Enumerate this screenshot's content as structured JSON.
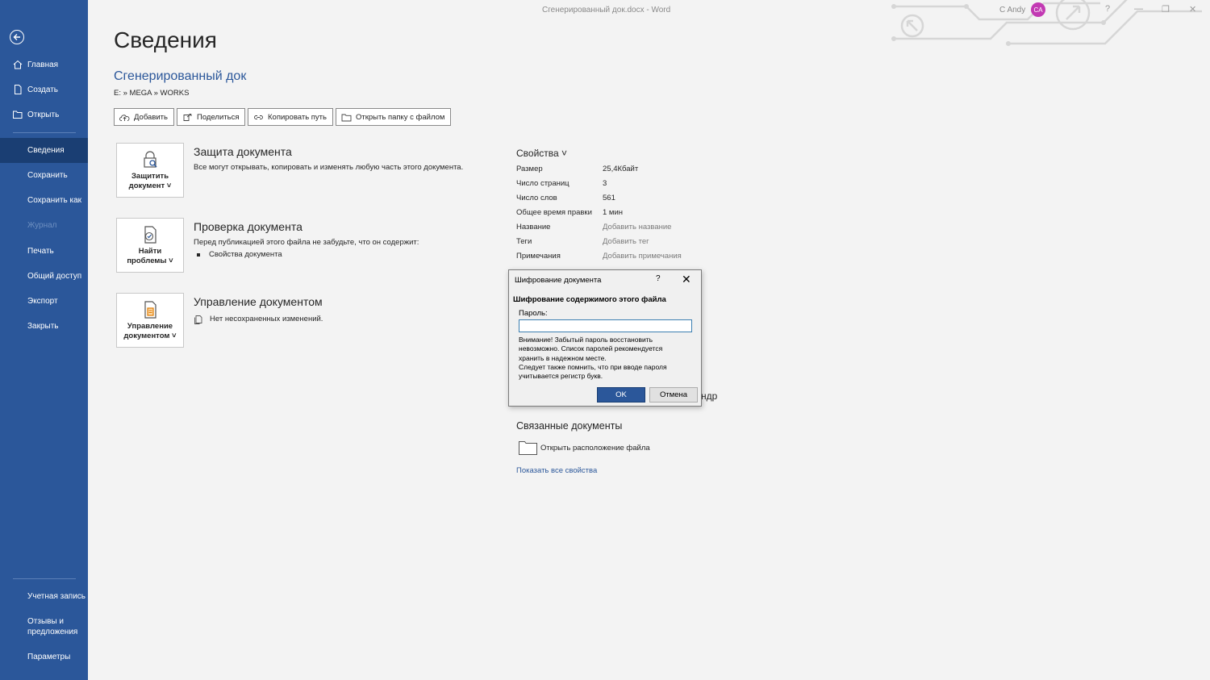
{
  "titlebar": {
    "doc_title": "Сгенерированный док.docx  -  Word",
    "user_name": "C Andy",
    "avatar_initials": "CA",
    "help": "?",
    "minimize": "—",
    "restore": "❐",
    "close": "✕"
  },
  "sidebar": {
    "back_icon": "back-arrow-icon",
    "items": [
      {
        "label": "Главная",
        "icon": "home-icon"
      },
      {
        "label": "Создать",
        "icon": "new-document-icon"
      },
      {
        "label": "Открыть",
        "icon": "open-folder-icon"
      },
      {
        "label": "Сведения",
        "active": true
      },
      {
        "label": "Сохранить"
      },
      {
        "label": "Сохранить как"
      },
      {
        "label": "Журнал",
        "disabled": true
      },
      {
        "label": "Печать"
      },
      {
        "label": "Общий доступ"
      },
      {
        "label": "Экспорт"
      },
      {
        "label": "Закрыть"
      }
    ],
    "bottom_items": [
      {
        "label": "Учетная запись"
      },
      {
        "label": "Отзывы и предложения"
      },
      {
        "label": "Параметры"
      }
    ]
  },
  "main": {
    "heading": "Сведения",
    "doc_name": "Сгенерированный док",
    "doc_path": "E: » MEGA » WORKS",
    "actions": [
      {
        "label": "Добавить",
        "icon": "cloud-upload-icon"
      },
      {
        "label": "Поделиться",
        "icon": "share-icon"
      },
      {
        "label": "Копировать путь",
        "icon": "link-icon"
      },
      {
        "label": "Открыть папку с файлом",
        "icon": "folder-icon"
      }
    ],
    "sections": [
      {
        "button_label": "Защитить документ ˅",
        "icon": "lock-search-icon",
        "title": "Защита документа",
        "text": "Все могут открывать, копировать и изменять любую часть этого документа."
      },
      {
        "button_label": "Найти проблемы ˅",
        "icon": "document-check-icon",
        "title": "Проверка документа",
        "text": "Перед публикацией этого файла не забудьте, что он содержит:",
        "bullet": "Свойства документа"
      },
      {
        "button_label": "Управление документом ˅",
        "icon": "document-manage-icon",
        "title": "Управление документом",
        "text": "Нет несохраненных изменений."
      }
    ]
  },
  "properties": {
    "heading": "Свойства ˅",
    "rows": [
      {
        "label": "Размер",
        "value": "25,4Кбайт"
      },
      {
        "label": "Число страниц",
        "value": "3"
      },
      {
        "label": "Число слов",
        "value": "561"
      },
      {
        "label": "Общее время правки",
        "value": "1 мин"
      },
      {
        "label": "Название",
        "value": "Добавить название"
      },
      {
        "label": "Теги",
        "value": "Добавить тег"
      },
      {
        "label": "Примечания",
        "value": "Добавить примечания"
      }
    ],
    "partial_text": "ндр",
    "related_heading": "Связанные документы",
    "open_location": "Открыть расположение файла",
    "show_all": "Показать все свойства"
  },
  "dialog": {
    "title": "Шифрование документа",
    "help": "?",
    "close": "✕",
    "heading": "Шифрование содержимого этого файла",
    "password_label": "Пароль:",
    "password_value": "",
    "warning_lines": [
      "Внимание! Забытый пароль восстановить",
      "невозможно. Список паролей рекомендуется",
      "хранить в надежном месте.",
      "Следует также помнить, что при вводе пароля",
      "учитывается регистр букв."
    ],
    "ok": "OK",
    "cancel": "Отмена"
  },
  "colors": {
    "accent": "#2b579a",
    "sidebar_active": "#1a3e73",
    "avatar": "#c239b3",
    "background": "#f3f3f3"
  }
}
